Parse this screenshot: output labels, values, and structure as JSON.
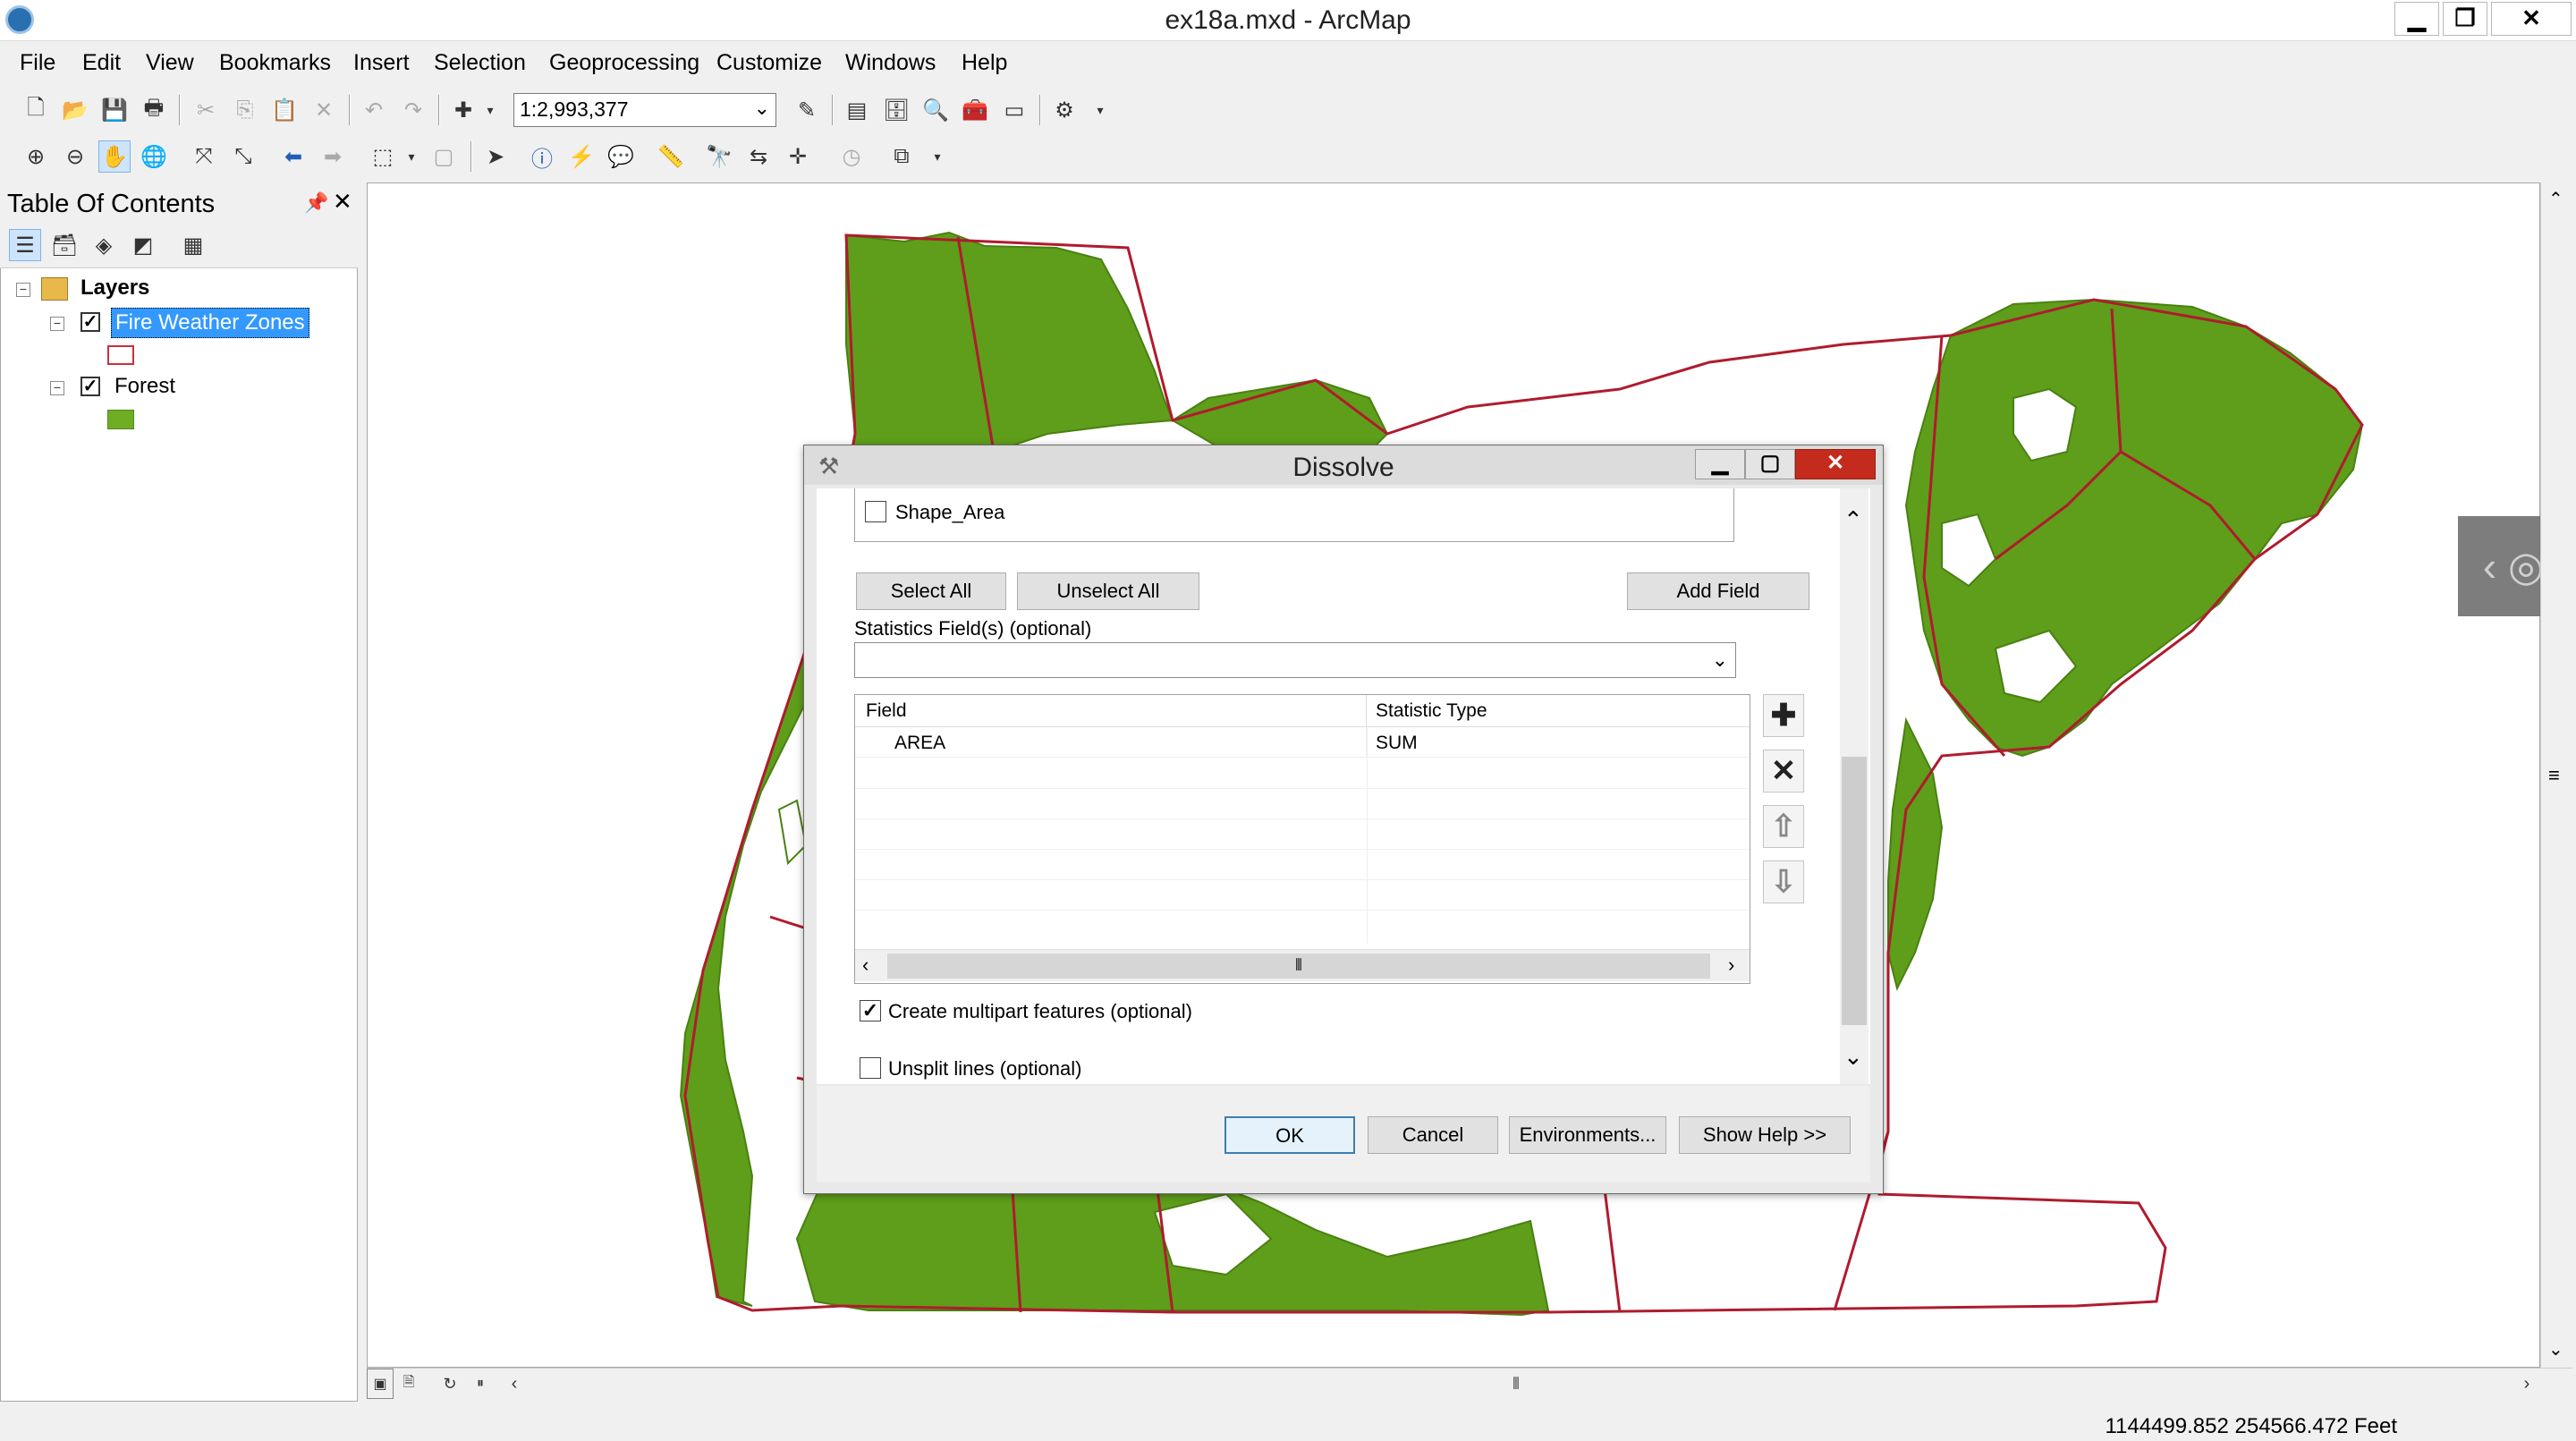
{
  "window": {
    "title": "ex18a.mxd - ArcMap",
    "minimize": "▁",
    "maximize": "❐",
    "close": "✕"
  },
  "menu": [
    "File",
    "Edit",
    "View",
    "Bookmarks",
    "Insert",
    "Selection",
    "Geoprocessing",
    "Customize",
    "Windows",
    "Help"
  ],
  "toolbar": {
    "scale": "1:2,993,377"
  },
  "toc": {
    "title": "Table Of Contents",
    "root": "Layers",
    "layers": [
      {
        "name": "Fire Weather Zones",
        "checked": true,
        "selected": true,
        "symbol_color": "#c8323c",
        "symbol_fill": "#ffffff"
      },
      {
        "name": "Forest",
        "checked": true,
        "selected": false,
        "symbol_color": "#4c8a1c",
        "symbol_fill": "#6fae24"
      }
    ]
  },
  "colors": {
    "forest": "#5e9e1a",
    "zone_outline": "#b01b2e",
    "accent": "#3399ff",
    "close_red": "#c42b1c"
  },
  "dialog": {
    "title": "Dissolve",
    "field_list_item": "Shape_Area",
    "select_all": "Select All",
    "unselect_all": "Unselect All",
    "add_field": "Add Field",
    "stats_label": "Statistics Field(s) (optional)",
    "table": {
      "headers": [
        "Field",
        "Statistic Type"
      ],
      "rows": [
        {
          "field": "AREA",
          "stat": "SUM"
        }
      ]
    },
    "multipart": {
      "label": "Create multipart features (optional)",
      "checked": true
    },
    "unsplit": {
      "label": "Unsplit lines (optional)",
      "checked": false
    },
    "buttons": {
      "ok": "OK",
      "cancel": "Cancel",
      "environments": "Environments...",
      "help": "Show Help >>"
    }
  },
  "status": {
    "coords": "1144499.852  254566.472 Feet"
  }
}
